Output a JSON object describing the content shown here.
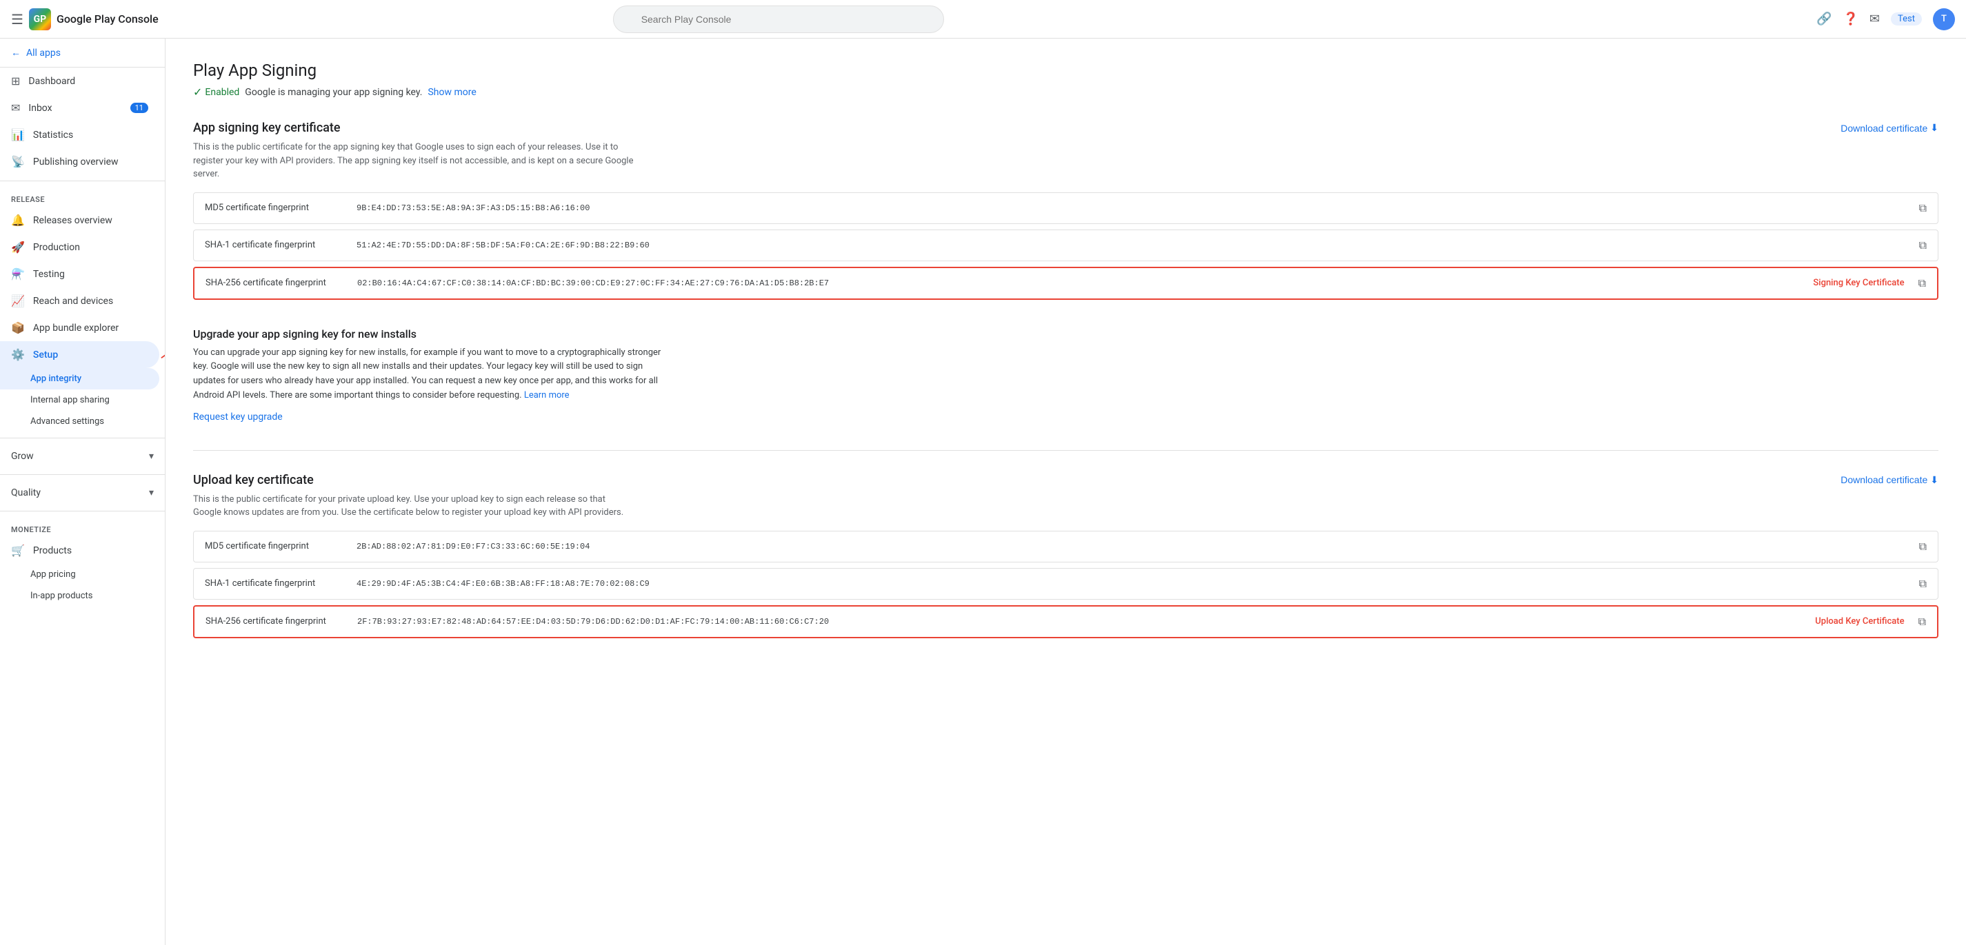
{
  "topbar": {
    "hamburger_label": "☰",
    "brand_text": "Google Play Console",
    "brand_short": "GP",
    "search_placeholder": "Search Play Console",
    "link_icon": "🔗",
    "help_icon": "?",
    "notification_icon": "✉",
    "test_label": "Test",
    "avatar_label": "T"
  },
  "sidebar": {
    "all_apps_label": "All apps",
    "nav_items": [
      {
        "id": "dashboard",
        "label": "Dashboard",
        "icon": "⊞"
      },
      {
        "id": "inbox",
        "label": "Inbox",
        "icon": "✉",
        "badge": "11"
      },
      {
        "id": "statistics",
        "label": "Statistics",
        "icon": "📊"
      },
      {
        "id": "publishing",
        "label": "Publishing overview",
        "icon": "📡"
      }
    ],
    "release_section": "Release",
    "release_items": [
      {
        "id": "releases-overview",
        "label": "Releases overview",
        "icon": "🔔"
      },
      {
        "id": "production",
        "label": "Production",
        "icon": "🚀"
      },
      {
        "id": "testing",
        "label": "Testing",
        "icon": "⚗️"
      },
      {
        "id": "reach-devices",
        "label": "Reach and devices",
        "icon": "📈"
      },
      {
        "id": "app-bundle",
        "label": "App bundle explorer",
        "icon": "📦"
      },
      {
        "id": "setup",
        "label": "Setup",
        "icon": "⚙️",
        "expanded": true
      }
    ],
    "setup_sub": [
      {
        "id": "app-integrity",
        "label": "App integrity",
        "active": true
      },
      {
        "id": "internal-app",
        "label": "Internal app sharing"
      },
      {
        "id": "advanced-settings",
        "label": "Advanced settings"
      }
    ],
    "grow_label": "Grow",
    "quality_label": "Quality",
    "monetize_label": "Monetize",
    "monetize_items": [
      {
        "id": "products",
        "label": "Products",
        "icon": "🛒"
      },
      {
        "id": "app-pricing",
        "label": "App pricing"
      },
      {
        "id": "in-app-products",
        "label": "In-app products"
      }
    ]
  },
  "main": {
    "page_title": "Play App Signing",
    "enabled_text": "Enabled",
    "managing_text": "Google is managing your app signing key.",
    "show_more": "Show more",
    "app_signing_cert": {
      "title": "App signing key certificate",
      "download_label": "Download certificate",
      "description": "This is the public certificate for the app signing key that Google uses to sign each of your releases. Use it to register your key with API providers. The app signing key itself is not accessible, and is kept on a secure Google server.",
      "rows": [
        {
          "label": "MD5 certificate fingerprint",
          "value": "9B:E4:DD:73:53:5E:A8:9A:3F:A3:D5:15:B8:A6:16:00",
          "highlighted": false,
          "tag": ""
        },
        {
          "label": "SHA-1 certificate fingerprint",
          "value": "51:A2:4E:7D:55:DD:DA:8F:5B:DF:5A:F0:CA:2E:6F:9D:B8:22:B9:60",
          "highlighted": false,
          "tag": ""
        },
        {
          "label": "SHA-256 certificate fingerprint",
          "value": "02:B0:16:4A:C4:67:CF:C0:38:14:0A:CF:BD:BC:39:00:CD:E9:27:0C:FF:34:AE:27:C9:76:DA:A1:D5:B8:2B:E7",
          "highlighted": true,
          "tag": "Signing Key Certificate"
        }
      ]
    },
    "upgrade_section": {
      "title": "Upgrade your app signing key for new installs",
      "description": "You can upgrade your app signing key for new installs, for example if you want to move to a cryptographically stronger key. Google will use the new key to sign all new installs and their updates. Your legacy key will still be used to sign updates for users who already have your app installed. You can request a new key once per app, and this works for all Android API levels. There are some important things to consider before requesting.",
      "learn_more": "Learn more",
      "request_label": "Request key upgrade"
    },
    "upload_cert": {
      "title": "Upload key certificate",
      "download_label": "Download certificate",
      "description": "This is the public certificate for your private upload key. Use your upload key to sign each release so that Google knows updates are from you. Use the certificate below to register your upload key with API providers.",
      "rows": [
        {
          "label": "MD5 certificate fingerprint",
          "value": "2B:AD:88:02:A7:81:D9:E0:F7:C3:33:6C:60:5E:19:04",
          "highlighted": false,
          "tag": ""
        },
        {
          "label": "SHA-1 certificate fingerprint",
          "value": "4E:29:9D:4F:A5:3B:C4:4F:E0:6B:3B:A8:FF:18:A8:7E:70:02:08:C9",
          "highlighted": false,
          "tag": ""
        },
        {
          "label": "SHA-256 certificate fingerprint",
          "value": "2F:7B:93:27:93:E7:82:48:AD:64:57:EE:D4:03:5D:79:D6:DD:62:D0:D1:AF:FC:79:14:00:AB:11:60:C6:C7:20",
          "highlighted": true,
          "tag": "Upload Key Certificate"
        }
      ]
    }
  }
}
